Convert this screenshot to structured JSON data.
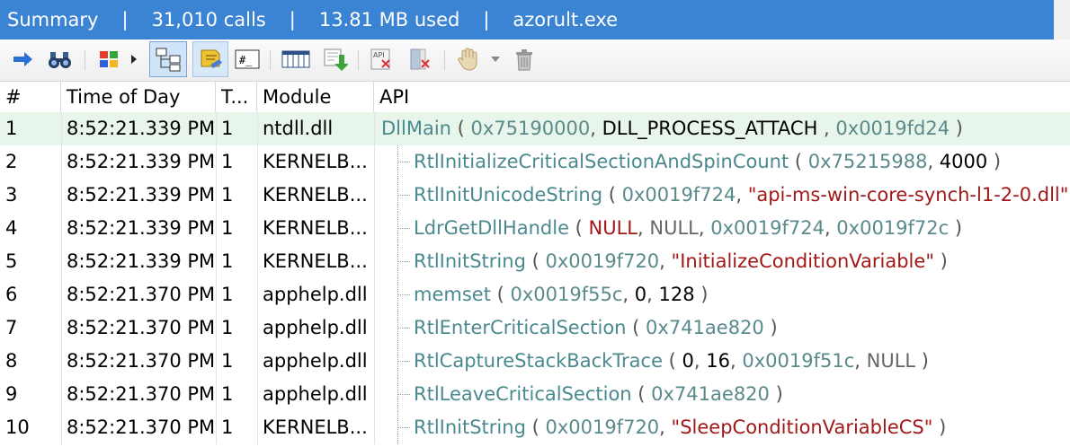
{
  "titlebar": {
    "summary": "Summary",
    "sep": "|",
    "calls": "31,010 calls",
    "memory": "13.81 MB used",
    "process": "azorult.exe"
  },
  "toolbar": {
    "icons": [
      "forward-arrow-icon",
      "binoculars-icon",
      "color-blocks-icon",
      "expand-arrow-icon",
      "tree-view-icon",
      "highlight-icon",
      "hex-icon",
      "columns-icon",
      "export-icon",
      "api-delete-icon",
      "delete-column-icon",
      "hand-icon",
      "dropdown-icon",
      "trash-icon"
    ]
  },
  "columns": [
    "#",
    "Time of Day",
    "T...",
    "Module",
    "API"
  ],
  "rows": [
    {
      "num": "1",
      "time": "8:52:21.339 PM",
      "thread": "1",
      "module": "ntdll.dll",
      "indent": false,
      "api": "DllMain",
      "parts": [
        {
          "t": "0x75190000",
          "c": "hex"
        },
        {
          "t": ", ",
          "c": "punct"
        },
        {
          "t": "DLL_PROCESS_ATTACH",
          "c": "plain"
        },
        {
          "t": " , ",
          "c": "punct"
        },
        {
          "t": "0x0019fd24",
          "c": "hex"
        }
      ]
    },
    {
      "num": "2",
      "time": "8:52:21.339 PM",
      "thread": "1",
      "module": "KERNELB...",
      "indent": true,
      "api": "RtlInitializeCriticalSectionAndSpinCount",
      "parts": [
        {
          "t": "0x75215988",
          "c": "hex"
        },
        {
          "t": ", ",
          "c": "punct"
        },
        {
          "t": "4000",
          "c": "plain"
        }
      ]
    },
    {
      "num": "3",
      "time": "8:52:21.339 PM",
      "thread": "1",
      "module": "KERNELB...",
      "indent": true,
      "api": "RtlInitUnicodeString",
      "parts": [
        {
          "t": "0x0019f724",
          "c": "hex"
        },
        {
          "t": ", ",
          "c": "punct"
        },
        {
          "t": "\"api-ms-win-core-synch-l1-2-0.dll\"",
          "c": "str"
        }
      ]
    },
    {
      "num": "4",
      "time": "8:52:21.339 PM",
      "thread": "1",
      "module": "KERNELB...",
      "indent": true,
      "api": "LdrGetDllHandle",
      "parts": [
        {
          "t": "NULL",
          "c": "nul"
        },
        {
          "t": ", ",
          "c": "punct"
        },
        {
          "t": "NULL",
          "c": "nul2"
        },
        {
          "t": ", ",
          "c": "punct"
        },
        {
          "t": "0x0019f724",
          "c": "hex"
        },
        {
          "t": ", ",
          "c": "punct"
        },
        {
          "t": "0x0019f72c",
          "c": "hex"
        }
      ]
    },
    {
      "num": "5",
      "time": "8:52:21.339 PM",
      "thread": "1",
      "module": "KERNELB...",
      "indent": true,
      "api": "RtlInitString",
      "parts": [
        {
          "t": "0x0019f720",
          "c": "hex"
        },
        {
          "t": ", ",
          "c": "punct"
        },
        {
          "t": "\"InitializeConditionVariable\"",
          "c": "str"
        }
      ]
    },
    {
      "num": "6",
      "time": "8:52:21.370 PM",
      "thread": "1",
      "module": "apphelp.dll",
      "indent": true,
      "api": "memset",
      "parts": [
        {
          "t": "0x0019f55c",
          "c": "hex"
        },
        {
          "t": ", ",
          "c": "punct"
        },
        {
          "t": "0",
          "c": "plain"
        },
        {
          "t": ", ",
          "c": "punct"
        },
        {
          "t": "128",
          "c": "plain"
        }
      ]
    },
    {
      "num": "7",
      "time": "8:52:21.370 PM",
      "thread": "1",
      "module": "apphelp.dll",
      "indent": true,
      "api": "RtlEnterCriticalSection",
      "parts": [
        {
          "t": "0x741ae820",
          "c": "hex"
        }
      ]
    },
    {
      "num": "8",
      "time": "8:52:21.370 PM",
      "thread": "1",
      "module": "apphelp.dll",
      "indent": true,
      "api": "RtlCaptureStackBackTrace",
      "parts": [
        {
          "t": "0",
          "c": "plain"
        },
        {
          "t": ", ",
          "c": "punct"
        },
        {
          "t": "16",
          "c": "plain"
        },
        {
          "t": ", ",
          "c": "punct"
        },
        {
          "t": "0x0019f51c",
          "c": "hex"
        },
        {
          "t": ", ",
          "c": "punct"
        },
        {
          "t": "NULL",
          "c": "nul2"
        }
      ]
    },
    {
      "num": "9",
      "time": "8:52:21.370 PM",
      "thread": "1",
      "module": "apphelp.dll",
      "indent": true,
      "api": "RtlLeaveCriticalSection",
      "parts": [
        {
          "t": "0x741ae820",
          "c": "hex"
        }
      ]
    },
    {
      "num": "10",
      "time": "8:52:21.370 PM",
      "thread": "1",
      "module": "KERNELB...",
      "indent": true,
      "api": "RtlInitString",
      "parts": [
        {
          "t": "0x0019f720",
          "c": "hex"
        },
        {
          "t": ", ",
          "c": "punct"
        },
        {
          "t": "\"SleepConditionVariableCS\"",
          "c": "str"
        }
      ]
    }
  ]
}
